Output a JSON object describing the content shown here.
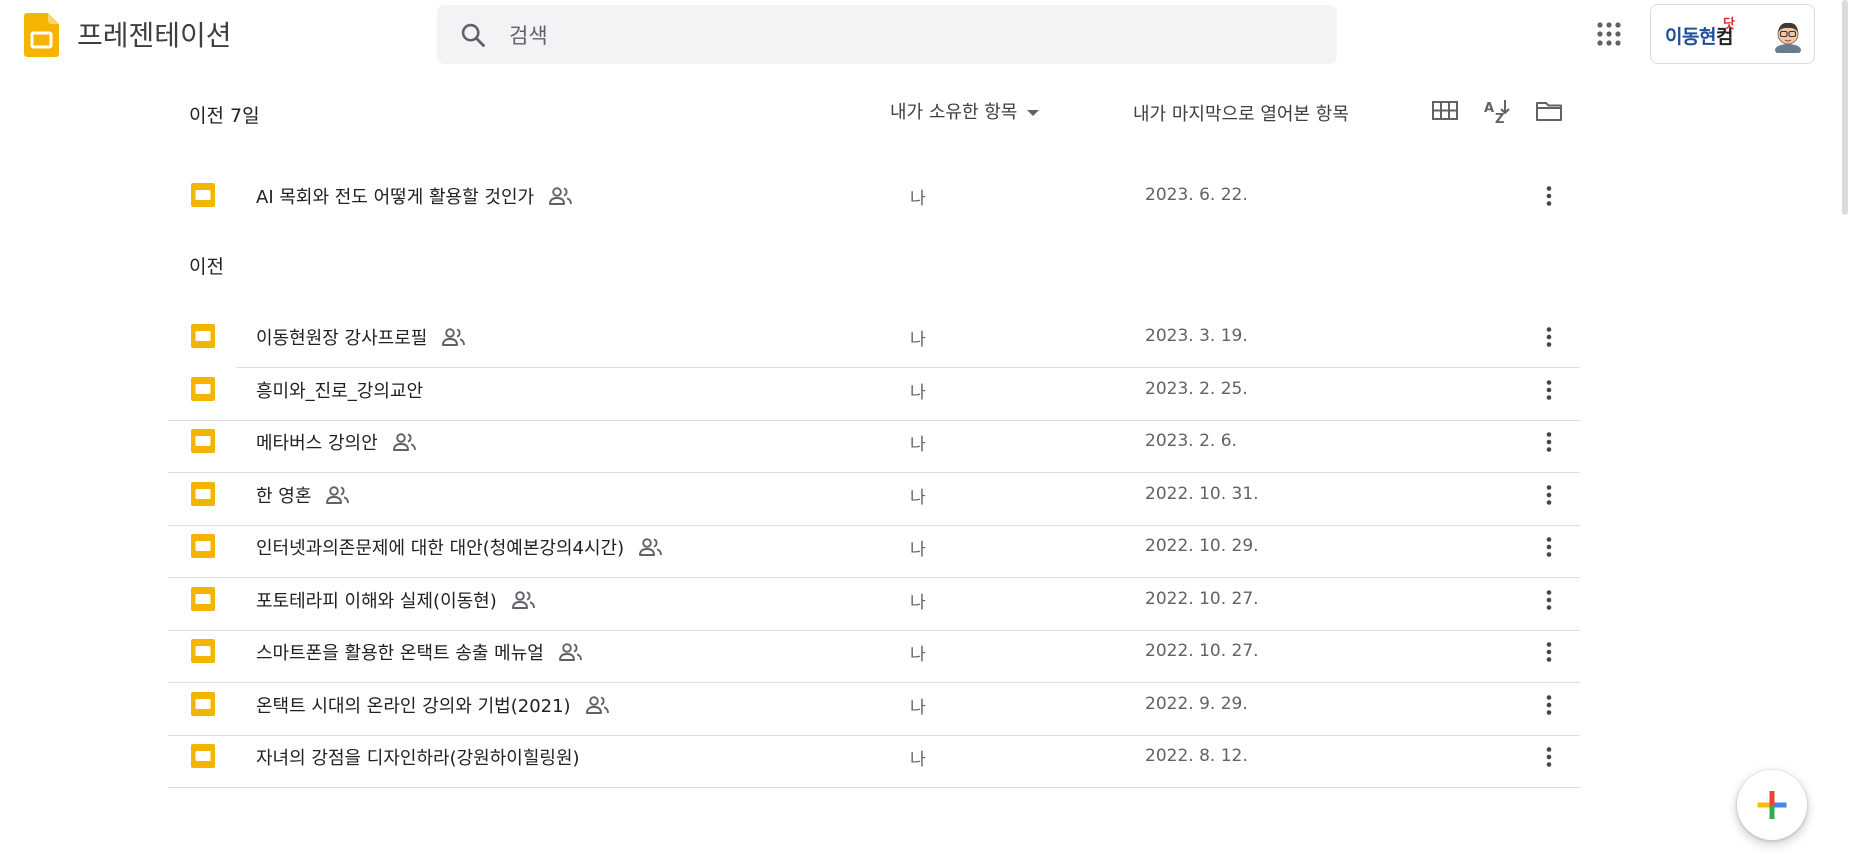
{
  "app": {
    "title": "프레젠테이션",
    "logo_icon": "slides-logo-icon",
    "brand_color": "#f4b400"
  },
  "search": {
    "placeholder": "검색",
    "value": ""
  },
  "account": {
    "brand_text": "이동현",
    "brand_suffix": "컴",
    "brand_mark": "닷",
    "avatar_icon": "avatar-illustration"
  },
  "list_header": {
    "section_title": "이전 7일",
    "owner_filter": "내가 소유한 항목",
    "sort_label": "내가 마지막으로 열어본 항목",
    "view_icons": [
      "grid-view-icon",
      "sort-az-icon",
      "folder-icon"
    ]
  },
  "groups": {
    "recent": {
      "rows": [
        {
          "name": "AI 목회와 전도 어떻게 활용할 것인가",
          "shared": true,
          "owner": "나",
          "date": "2023. 6. 22."
        }
      ]
    },
    "earlier": {
      "label": "이전",
      "rows": [
        {
          "name": "이동현원장 강사프로필",
          "shared": true,
          "owner": "나",
          "date": "2023. 3. 19."
        },
        {
          "name": "흥미와_진로_강의교안",
          "shared": false,
          "owner": "나",
          "date": "2023. 2. 25."
        },
        {
          "name": "메타버스 강의안",
          "shared": true,
          "owner": "나",
          "date": "2023. 2. 6."
        },
        {
          "name": "한 영혼",
          "shared": true,
          "owner": "나",
          "date": "2022. 10. 31."
        },
        {
          "name": "인터넷과의존문제에 대한 대안(청예본강의4시간)",
          "shared": true,
          "owner": "나",
          "date": "2022. 10. 29."
        },
        {
          "name": "포토테라피 이해와 실제(이동현)",
          "shared": true,
          "owner": "나",
          "date": "2022. 10. 27."
        },
        {
          "name": "스마트폰을 활용한 온택트 송출 메뉴얼",
          "shared": true,
          "owner": "나",
          "date": "2022. 10. 27."
        },
        {
          "name": "온택트 시대의 온라인 강의와 기법(2021)",
          "shared": true,
          "owner": "나",
          "date": "2022. 9. 29."
        },
        {
          "name": "자녀의 강점을 디자인하라(강원하이힐링원)",
          "shared": false,
          "owner": "나",
          "date": "2022. 8. 12."
        }
      ]
    }
  },
  "colors": {
    "accent": "#f4b400",
    "text_secondary": "#5f6368",
    "divider": "#e0e0e0"
  }
}
